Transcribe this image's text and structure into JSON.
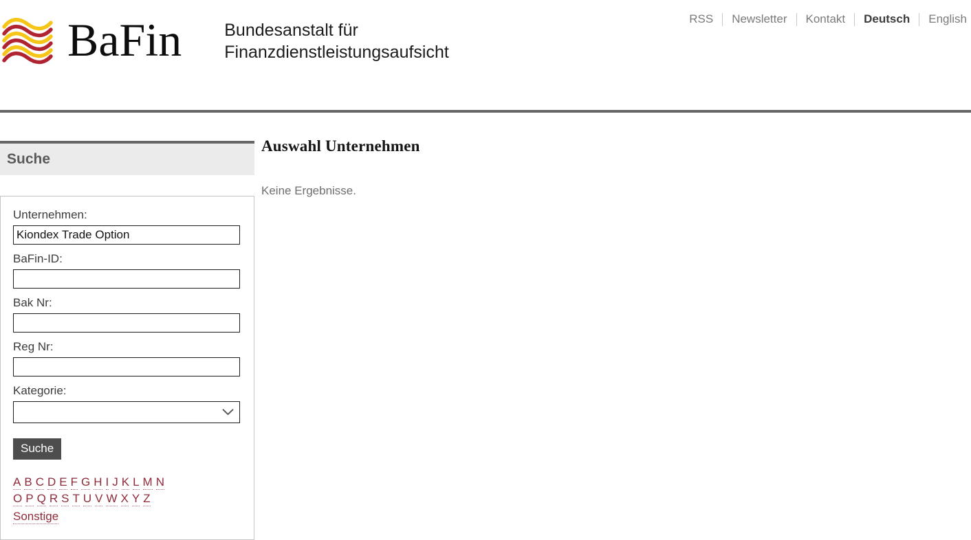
{
  "header": {
    "logo": {
      "icon_name": "bafin-waves-logo",
      "wordmark": "BaFin",
      "wave_colors": [
        "#f5c518",
        "#b02432"
      ]
    },
    "subtitle_line1": "Bundesanstalt für",
    "subtitle_line2": "Finanzdienstleistungsaufsicht",
    "topnav": [
      {
        "label": "RSS",
        "active": false
      },
      {
        "label": "Newsletter",
        "active": false
      },
      {
        "label": "Kontakt",
        "active": false
      },
      {
        "label": "Deutsch",
        "active": true
      },
      {
        "label": "English",
        "active": false
      }
    ]
  },
  "sidebar": {
    "heading": "Suche",
    "fields": {
      "unternehmen": {
        "label": "Unternehmen:",
        "value": "Kiondex Trade Option",
        "placeholder": ""
      },
      "bafin_id": {
        "label": "BaFin-ID:",
        "value": "",
        "placeholder": ""
      },
      "bak_nr": {
        "label": "Bak Nr:",
        "value": "",
        "placeholder": ""
      },
      "reg_nr": {
        "label": "Reg Nr:",
        "value": "",
        "placeholder": ""
      },
      "kategorie": {
        "label": "Kategorie:",
        "value": "",
        "options": [
          ""
        ],
        "chevron_icon": "chevron-down-icon"
      }
    },
    "submit_label": "Suche",
    "alphabet_row1": [
      "A",
      "B",
      "C",
      "D",
      "E",
      "F",
      "G",
      "H",
      "I",
      "J",
      "K",
      "L",
      "M",
      "N"
    ],
    "alphabet_row2": [
      "O",
      "P",
      "Q",
      "R",
      "S",
      "T",
      "U",
      "V",
      "W",
      "X",
      "Y",
      "Z"
    ],
    "other_label": "Sonstige",
    "link_color": "#8f2a3a"
  },
  "main": {
    "title": "Auswahl Unternehmen",
    "empty_message": "Keine Ergebnisse."
  },
  "colors": {
    "rule": "#676767",
    "panel_header_bg": "#ebebeb",
    "button_bg": "#4d4d4d",
    "muted_text": "#6e6e6e"
  }
}
